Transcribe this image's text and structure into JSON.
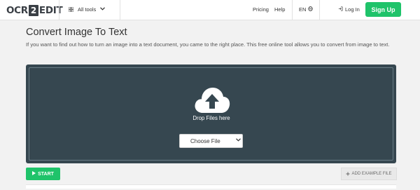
{
  "header": {
    "logo": {
      "left": "OCR",
      "mid": "2",
      "right": "EDIT"
    },
    "all_tools": "All tools",
    "pricing": "Pricing",
    "help": "Help",
    "language": "EN",
    "login": "Log In",
    "signup": "Sign Up"
  },
  "main": {
    "title": "Convert Image To Text",
    "description": "If you want to find out how to turn an image into a text document, you came to the right place. This free online tool allows you to convert from image to text."
  },
  "upload": {
    "drop_text": "Drop Files here",
    "choose_file": "Choose File"
  },
  "actions": {
    "start": "START",
    "add_example": "ADD EXAMPLE FILE"
  },
  "colors": {
    "accent": "#1fc36a",
    "drop_bg": "#364750",
    "page_bg": "#f2f2f2"
  },
  "icons": [
    "grid-icon",
    "chevron-down-icon",
    "globe-icon",
    "login-icon",
    "cloud-upload-icon",
    "play-icon",
    "plus-icon"
  ]
}
